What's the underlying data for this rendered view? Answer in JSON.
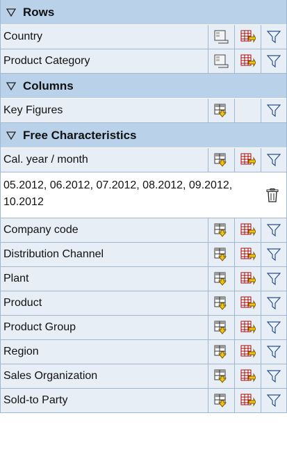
{
  "sections": {
    "rows": {
      "title": "Rows",
      "items": [
        "Country",
        "Product Category"
      ]
    },
    "columns": {
      "title": "Columns",
      "items": [
        "Key Figures"
      ]
    },
    "free": {
      "title": "Free Characteristics",
      "first_item": "Cal. year / month",
      "filter_value": "05.2012, 06.2012, 07.2012, 08.2012, 09.2012, 10.2012",
      "items": [
        "Company code",
        "Distribution Channel",
        "Plant",
        "Product",
        "Product Group",
        "Region",
        "Sales Organization",
        "Sold-to Party"
      ]
    }
  },
  "icons": {
    "collapse": "triangle-down-icon",
    "remove_drilldown": "remove-drilldown-icon",
    "swap_axis": "swap-axis-icon",
    "filter": "filter-icon",
    "drilldown_rows": "drilldown-rows-icon",
    "trash": "trash-icon"
  },
  "colors": {
    "section_bg": "#b9d2ea",
    "row_bg": "#e7eef6",
    "border": "#9fb7cf"
  }
}
